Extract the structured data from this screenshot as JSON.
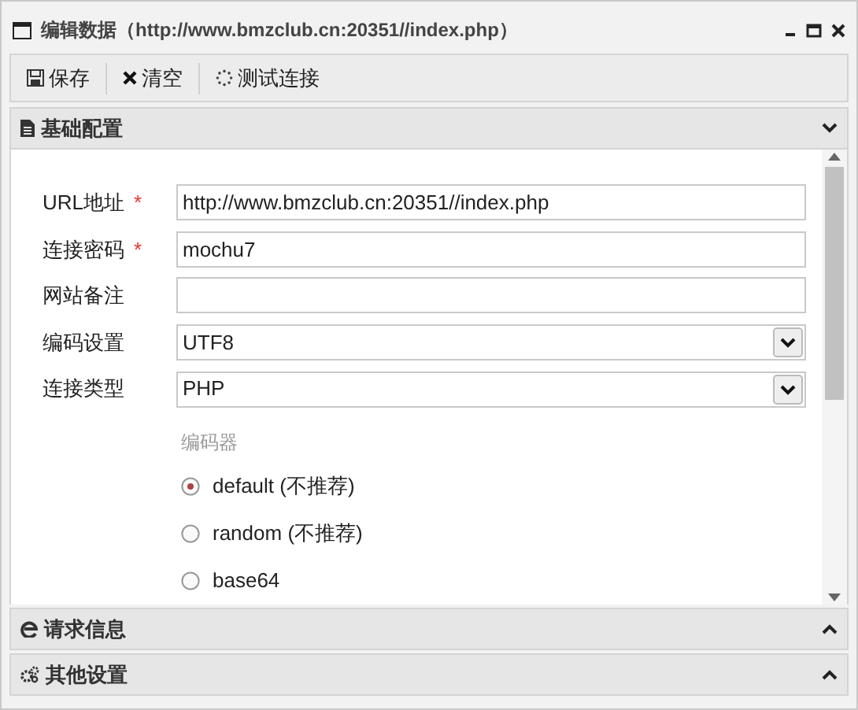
{
  "window": {
    "title": "编辑数据（http://www.bmzclub.cn:20351//index.php）"
  },
  "toolbar": [
    {
      "kind": "save",
      "label": "保存"
    },
    {
      "kind": "clear",
      "label": "清空"
    },
    {
      "kind": "test",
      "label": "测试连接"
    }
  ],
  "sections": [
    {
      "kind": "basic",
      "title": "基础配置",
      "expanded": true
    },
    {
      "kind": "request",
      "title": "请求信息",
      "expanded": false
    },
    {
      "kind": "other",
      "title": "其他设置",
      "expanded": false
    }
  ],
  "fields": [
    {
      "kind": "text",
      "label": "URL地址",
      "required_mark": "*",
      "value": "http://www.bmzclub.cn:20351//index.php"
    },
    {
      "kind": "text",
      "label": "连接密码",
      "required_mark": "*",
      "value": "mochu7"
    },
    {
      "kind": "text",
      "label": "网站备注"
    },
    {
      "kind": "select",
      "label": "编码设置",
      "value": "UTF8"
    },
    {
      "kind": "select",
      "label": "连接类型",
      "value": "PHP"
    }
  ],
  "encoder": {
    "label": "编码器",
    "options": [
      {
        "label": "default (不推荐)",
        "selected": true
      },
      {
        "label": "random (不推荐)",
        "selected": false
      },
      {
        "label": "base64",
        "selected": false
      }
    ]
  }
}
